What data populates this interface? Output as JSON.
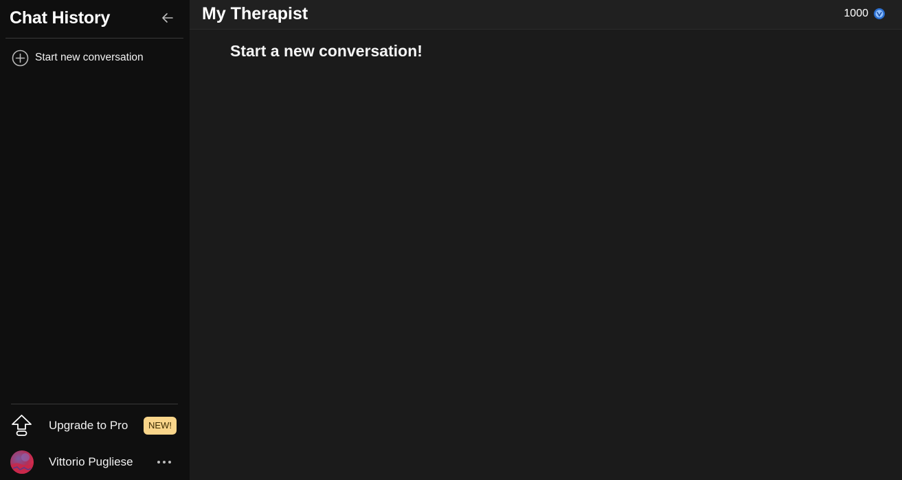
{
  "sidebar": {
    "title": "Chat History",
    "collapse_icon": "arrow-left-icon",
    "new_conversation": {
      "label": "Start new conversation",
      "icon": "plus-circle-icon"
    },
    "upgrade": {
      "label": "Upgrade to Pro",
      "badge": "NEW!",
      "icon": "upload-arrow-icon",
      "badge_color": "#f9d58a"
    },
    "user": {
      "name": "Vittorio Pugliese",
      "avatar_icon": "user-avatar",
      "more_icon": "more-horizontal-icon"
    }
  },
  "header": {
    "title": "My Therapist",
    "credits": "1000",
    "credits_icon": "coin-icon"
  },
  "main": {
    "empty_state_heading": "Start a new conversation!"
  },
  "colors": {
    "sidebar_bg": "#0f0f0f",
    "main_bg": "#1b1b1b",
    "header_bg": "#202020",
    "accent_blue": "#4a8fe0"
  }
}
